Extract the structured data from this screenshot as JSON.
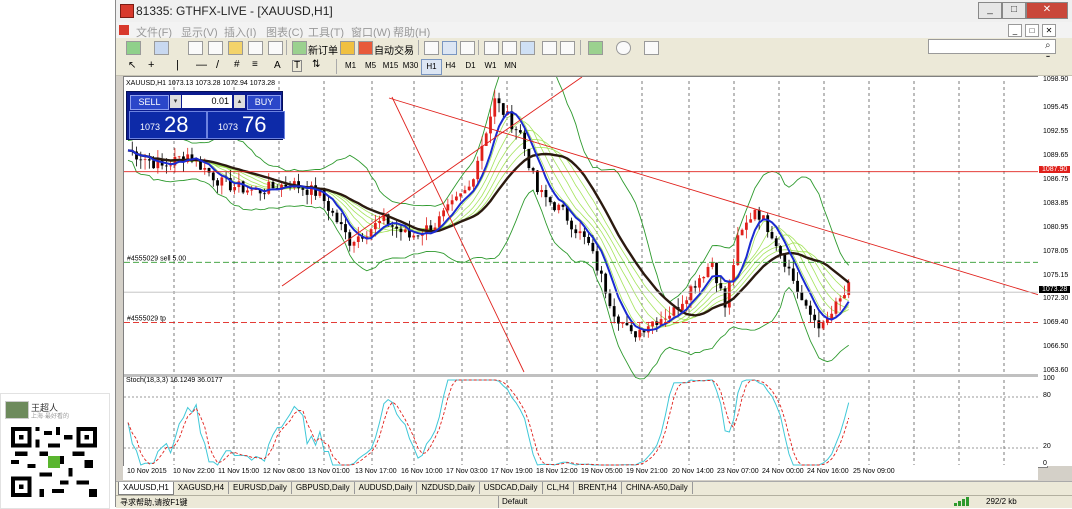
{
  "window": {
    "title": "81335: GTHFX-LIVE - [XAUUSD,H1]",
    "caption_buttons": [
      "_",
      "□",
      "✕"
    ],
    "inner_buttons": [
      "_",
      "□",
      "✕"
    ]
  },
  "menu": [
    "文件(F)",
    "显示(V)",
    "插入(I)",
    "图表(C)",
    "工具(T)",
    "窗口(W)",
    "帮助(H)"
  ],
  "toolbar": {
    "new_order": "新订单",
    "auto_trade": "自动交易",
    "timeframes": [
      "M1",
      "M5",
      "M15",
      "M30",
      "H1",
      "H4",
      "D1",
      "W1",
      "MN"
    ],
    "active_timeframe": "H1",
    "text_tool_label": "A",
    "text_label_tool": "T"
  },
  "search": {
    "placeholder": "",
    "value": ""
  },
  "chart": {
    "symbol_line": "XAUUSD,H1  1073.13 1073.28 1072.94 1073.28",
    "price_labels": [
      "1098.90",
      "1095.45",
      "1092.55",
      "1089.65",
      "1086.75",
      "1083.85",
      "1080.95",
      "1078.05",
      "1075.15",
      "1072.30",
      "1069.40",
      "1066.50",
      "1063.60"
    ],
    "highlight_price": {
      "value": "1087.90",
      "color": "#e0201b"
    },
    "current_price": {
      "value": "1073.28",
      "color": "#000000"
    },
    "order_labels": {
      "sell": "#4555029 sell 5.00",
      "tp": "#4555029 tp"
    },
    "date_labels": [
      "10 Nov 2015",
      "10 Nov 22:00",
      "11 Nov 15:00",
      "12 Nov 08:00",
      "13 Nov 01:00",
      "13 Nov 17:00",
      "16 Nov 10:00",
      "17 Nov 03:00",
      "17 Nov 19:00",
      "18 Nov 12:00",
      "19 Nov 05:00",
      "19 Nov 21:00",
      "20 Nov 14:00",
      "23 Nov 07:00",
      "24 Nov 00:00",
      "24 Nov 16:00",
      "25 Nov 09:00"
    ],
    "stoch_label": "Stoch(18,3,3) 16.1249 36.0177",
    "stoch_levels": [
      "100",
      "80",
      "20",
      "0"
    ],
    "colors": {
      "bull_candle": "#e0201b",
      "bear_candle": "#000000",
      "ma_blue": "#1b2bd1",
      "ma_dark": "#2b1a0f",
      "bands": "#2e9a2e",
      "ribbon": "#9be14a",
      "trendline": "#e0201b",
      "stoch_main": "#40c8d8",
      "stoch_signal": "#e0201b"
    }
  },
  "trade_panel": {
    "sell_label": "SELL",
    "buy_label": "BUY",
    "lot": "0.01",
    "bid_small": "1073",
    "bid_big": "28",
    "ask_small": "1073",
    "ask_big": "76"
  },
  "tabs": [
    "XAUUSD,H1",
    "XAGUSD,H4",
    "EURUSD,Daily",
    "GBPUSD,Daily",
    "AUDUSD,Daily",
    "NZDUSD,Daily",
    "USDCAD,Daily",
    "CL,H4",
    "BRENT,H4",
    "CHINA-A50,Daily"
  ],
  "active_tab": "XAUUSD,H1",
  "status": {
    "help": "寻求帮助,请按F1键",
    "profile": "Default",
    "traffic": "292/2 kb"
  },
  "qr_panel": {
    "name": "王超人",
    "subtitle": "上海·最好看的"
  }
}
